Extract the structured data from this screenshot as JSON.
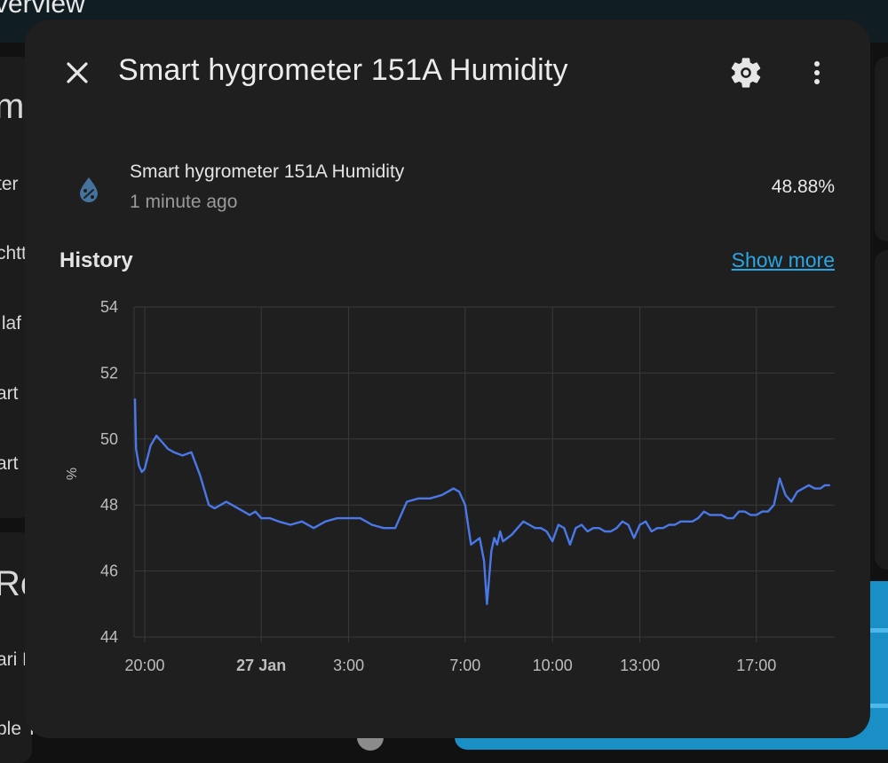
{
  "background": {
    "topbar_title": "verview",
    "side_texts": [
      "m",
      "ter",
      "chtt",
      "ılaf",
      "art",
      "art",
      "Ro",
      "ari L",
      "ple T"
    ]
  },
  "dialog": {
    "title": "Smart hygrometer 151A Humidity",
    "icons": {
      "close": "close-icon",
      "settings": "gear-icon",
      "more": "dots-vertical-icon",
      "entity": "water-percent-icon"
    },
    "entity": {
      "name": "Smart hygrometer 151A Humidity",
      "last_changed": "1 minute ago",
      "state": "48.88%"
    },
    "history": {
      "title": "History",
      "show_more": "Show more"
    }
  },
  "colors": {
    "accent": "#2aa6e4",
    "series": "#4a78e8",
    "dialog_bg": "#1f1f1f"
  },
  "chart_data": {
    "type": "line",
    "ylabel": "%",
    "ylim": [
      44,
      54
    ],
    "yticks": [
      44,
      46,
      48,
      50,
      52,
      54
    ],
    "x_labels": [
      {
        "label": "20:00",
        "h": 0,
        "bold": false
      },
      {
        "label": "27 Jan",
        "h": 4,
        "bold": true
      },
      {
        "label": "3:00",
        "h": 7,
        "bold": false
      },
      {
        "label": "7:00",
        "h": 11,
        "bold": false
      },
      {
        "label": "10:00",
        "h": 14,
        "bold": false
      },
      {
        "label": "13:00",
        "h": 17,
        "bold": false
      },
      {
        "label": "17:00",
        "h": 21,
        "bold": false
      }
    ],
    "x_range_hours": [
      -0.35,
      23.5
    ],
    "grid": true,
    "series": [
      {
        "x": [
          -0.35,
          -0.3,
          -0.2,
          -0.1,
          0,
          0.2,
          0.4,
          0.6,
          0.8,
          1.0,
          1.3,
          1.6,
          1.9,
          2.2,
          2.4,
          2.6,
          2.8,
          3.0,
          3.2,
          3.4,
          3.6,
          3.8,
          4.0,
          4.3,
          4.6,
          5.0,
          5.4,
          5.8,
          6.2,
          6.6,
          7.0,
          7.4,
          7.8,
          8.2,
          8.6,
          9.0,
          9.4,
          9.8,
          10.2,
          10.6,
          10.8,
          11.0,
          11.2,
          11.5,
          11.65,
          11.75,
          11.9,
          12.0,
          12.1,
          12.2,
          12.3,
          12.45,
          12.6,
          12.8,
          13.0,
          13.2,
          13.4,
          13.6,
          13.8,
          14.0,
          14.2,
          14.4,
          14.6,
          14.8,
          15.0,
          15.2,
          15.4,
          15.6,
          15.8,
          16.0,
          16.2,
          16.4,
          16.6,
          16.8,
          17.0,
          17.2,
          17.4,
          17.6,
          17.8,
          18.0,
          18.2,
          18.4,
          18.6,
          18.8,
          19.0,
          19.2,
          19.4,
          19.6,
          19.8,
          20.0,
          20.2,
          20.4,
          20.6,
          20.8,
          21.0,
          21.2,
          21.4,
          21.6,
          21.8,
          22.0,
          22.2,
          22.4,
          22.6,
          22.8,
          23.0,
          23.2,
          23.35,
          23.5
        ],
        "y": [
          51.2,
          49.7,
          49.2,
          49.0,
          49.1,
          49.8,
          50.1,
          49.9,
          49.7,
          49.6,
          49.5,
          49.6,
          48.9,
          48.0,
          47.9,
          48.0,
          48.1,
          48.0,
          47.9,
          47.8,
          47.7,
          47.8,
          47.6,
          47.6,
          47.5,
          47.4,
          47.5,
          47.3,
          47.5,
          47.6,
          47.6,
          47.6,
          47.4,
          47.3,
          47.3,
          48.1,
          48.2,
          48.2,
          48.3,
          48.5,
          48.4,
          48.0,
          46.8,
          47.0,
          46.3,
          45.0,
          46.6,
          47.0,
          46.8,
          47.2,
          46.9,
          47.0,
          47.1,
          47.3,
          47.5,
          47.4,
          47.3,
          47.3,
          47.2,
          46.9,
          47.4,
          47.3,
          46.8,
          47.3,
          47.4,
          47.2,
          47.3,
          47.3,
          47.2,
          47.2,
          47.3,
          47.5,
          47.4,
          47.0,
          47.4,
          47.5,
          47.2,
          47.3,
          47.3,
          47.4,
          47.4,
          47.5,
          47.5,
          47.5,
          47.6,
          47.8,
          47.7,
          47.7,
          47.7,
          47.6,
          47.6,
          47.8,
          47.8,
          47.7,
          47.7,
          47.8,
          47.8,
          48.0,
          48.8,
          48.3,
          48.1,
          48.4,
          48.5,
          48.6,
          48.5,
          48.5,
          48.6,
          48.6
        ]
      }
    ]
  }
}
